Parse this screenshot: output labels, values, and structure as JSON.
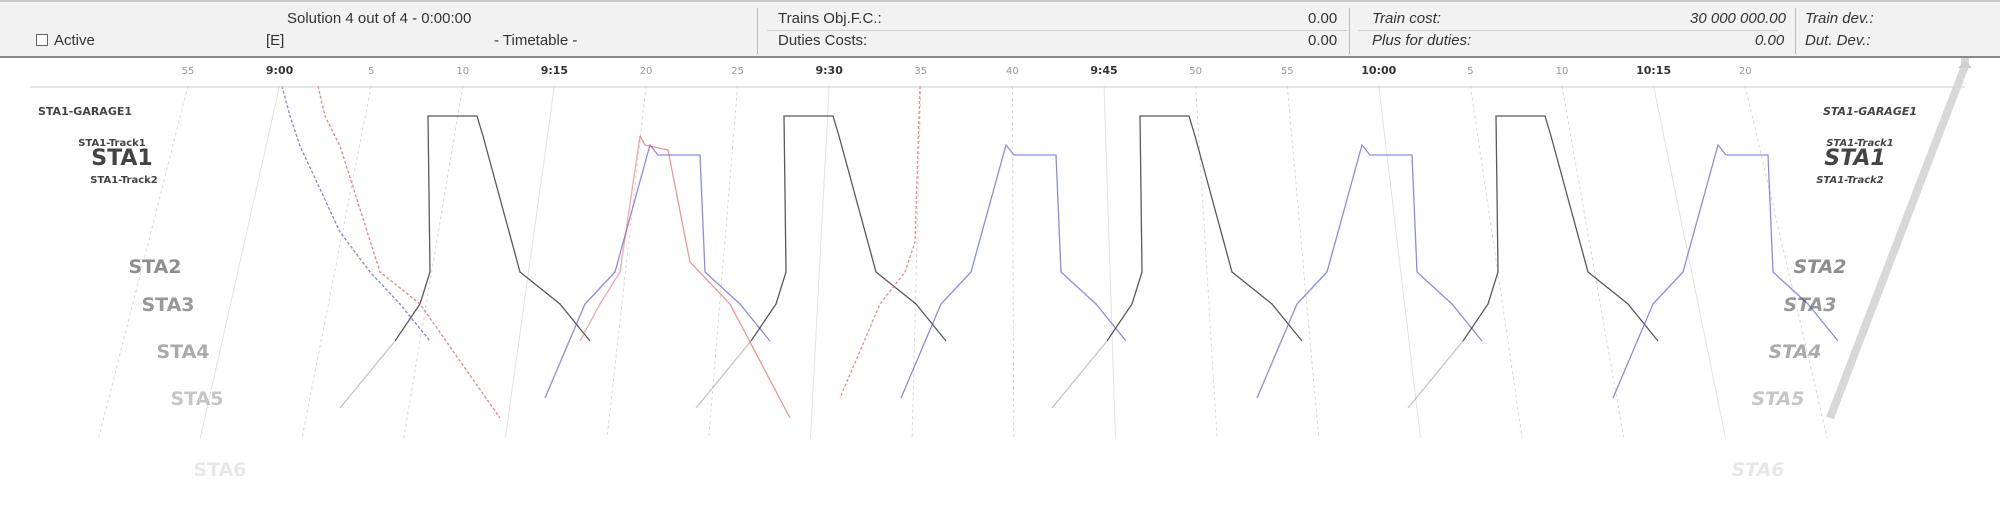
{
  "header": {
    "solution": "Solution 4 out of 4 - 0:00:00",
    "active_label": "Active",
    "active_checked": false,
    "editor_tag": "[E]",
    "view_label": "- Timetable -",
    "trains_obj_label": "Trains Obj.F.C.:",
    "trains_obj_value": "0.00",
    "duties_costs_label": "Duties Costs:",
    "duties_costs_value": "0.00",
    "train_cost_label": "Train cost:",
    "train_cost_value": "30 000 000.00",
    "plus_duties_label": "Plus for duties:",
    "plus_duties_value": "0.00",
    "train_dev_label": "Train dev.:",
    "dut_dev_label": "Dut. Dev.:"
  },
  "axis": {
    "ticks": [
      {
        "label": "55",
        "major": false
      },
      {
        "label": "9:00",
        "major": true
      },
      {
        "label": "5",
        "major": false
      },
      {
        "label": "10",
        "major": false
      },
      {
        "label": "9:15",
        "major": true
      },
      {
        "label": "20",
        "major": false
      },
      {
        "label": "25",
        "major": false
      },
      {
        "label": "9:30",
        "major": true
      },
      {
        "label": "35",
        "major": false
      },
      {
        "label": "40",
        "major": false
      },
      {
        "label": "9:45",
        "major": true
      },
      {
        "label": "50",
        "major": false
      },
      {
        "label": "55",
        "major": false
      },
      {
        "label": "10:00",
        "major": true
      },
      {
        "label": "5",
        "major": false
      },
      {
        "label": "10",
        "major": false
      },
      {
        "label": "10:15",
        "major": true
      },
      {
        "label": "20",
        "major": false
      }
    ]
  },
  "stations": [
    {
      "label": "STA1-GARAGE1",
      "style": "small"
    },
    {
      "label": "STA1-Track1",
      "style": "tiny"
    },
    {
      "label": "STA1",
      "style": "big"
    },
    {
      "label": "STA1-Track2",
      "style": "tiny"
    },
    {
      "label": "STA2",
      "style": "med"
    },
    {
      "label": "STA3",
      "style": "med"
    },
    {
      "label": "STA4",
      "style": "med"
    },
    {
      "label": "STA5",
      "style": "med"
    },
    {
      "label": "STA6",
      "style": "med"
    }
  ],
  "colors": {
    "black_train": "#3c3c3c",
    "blue_train": "#5a5ae6",
    "red_train": "#e85050",
    "grid": "#c8c8c8"
  }
}
